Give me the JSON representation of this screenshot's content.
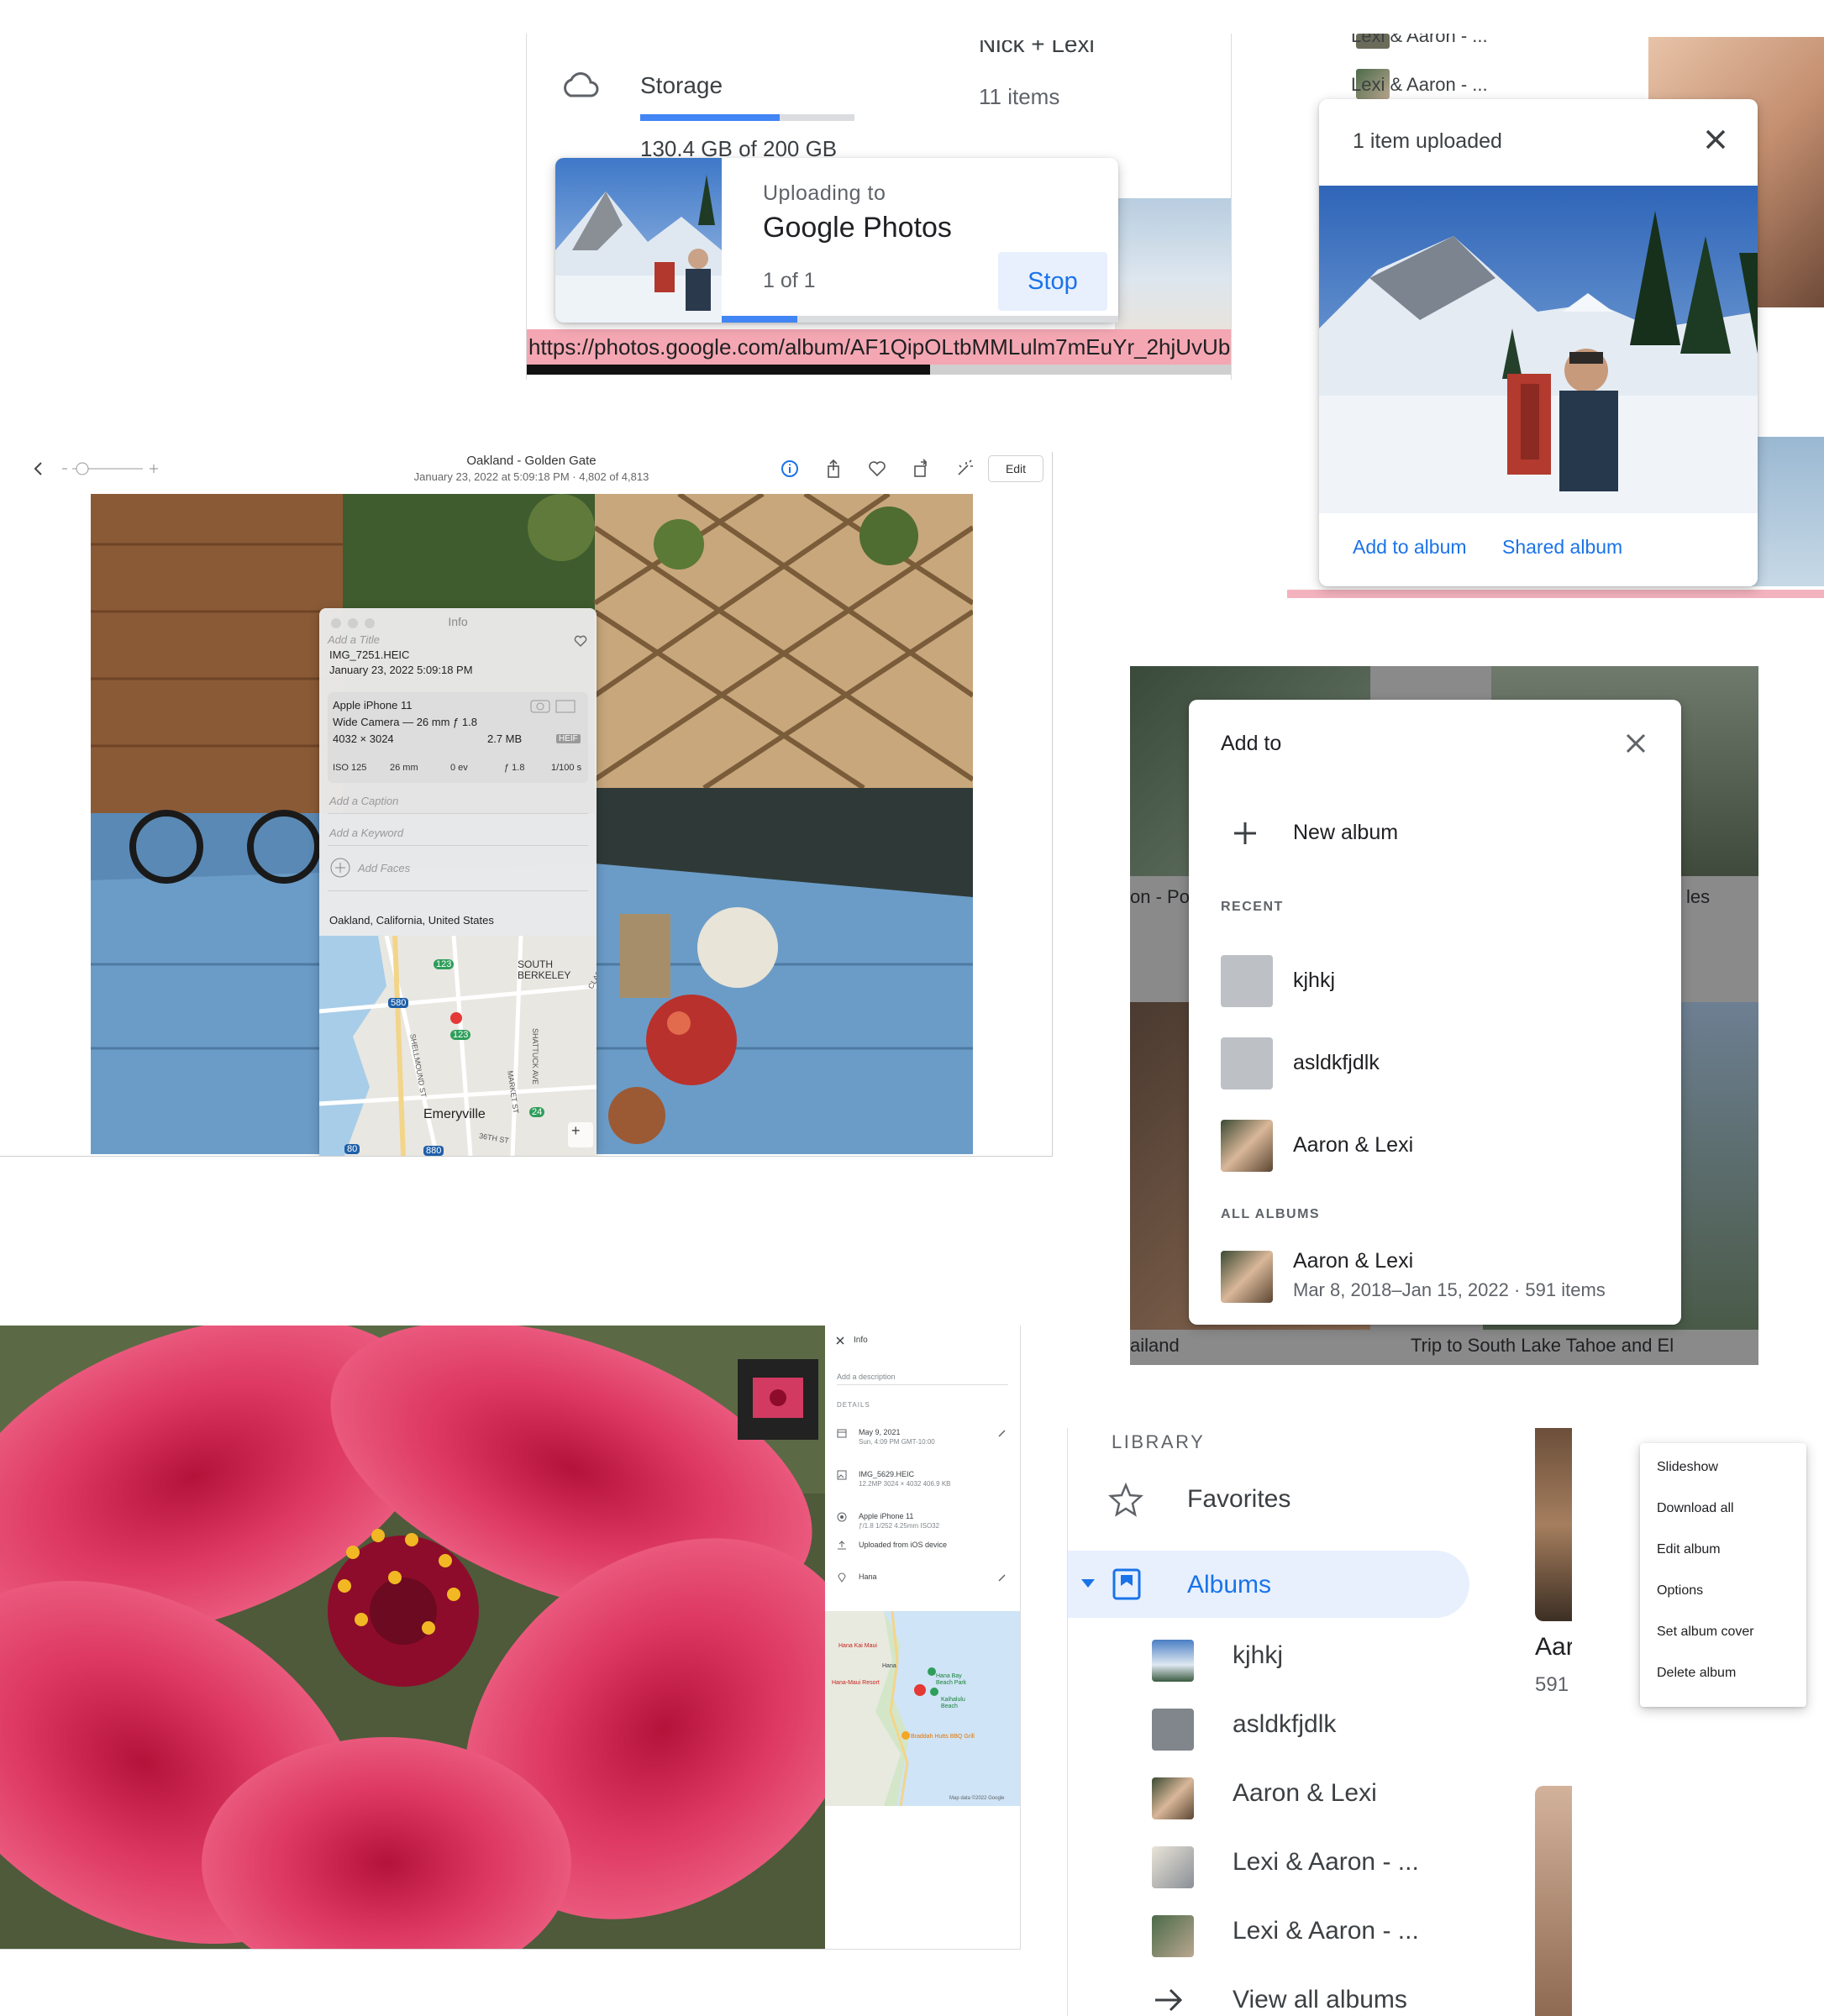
{
  "storage_panel": {
    "title": "Storage",
    "usage_text": "130.4 GB of 200 GB",
    "usage_fraction": 0.652,
    "album_title": "Nick + Lexi",
    "album_count": "11 items",
    "url": "https://photos.google.com/album/AF1QipOLtbMMLulm7mEuYr_2hjUvUb6",
    "icon": "cloud-icon",
    "toast": {
      "label": "Uploading to",
      "destination": "Google Photos",
      "count": "1 of 1",
      "stop_label": "Stop",
      "progress_fraction": 0.19
    }
  },
  "uploaded_panel": {
    "top_items": [
      "Lexi & Aaron - ...",
      "Lexi & Aaron - ..."
    ],
    "title": "1 item uploaded",
    "add_to_album_label": "Add to album",
    "shared_album_label": "Shared album",
    "close_icon": "close-icon"
  },
  "macos_photos": {
    "title": "Oakland - Golden Gate",
    "subtitle": "January 23, 2022 at 5:09:18 PM  ·  4,802 of 4,813",
    "edit_label": "Edit",
    "info": {
      "header": "Info",
      "add_title": "Add a Title",
      "filename": "IMG_7251.HEIC",
      "datetime": "January 23, 2022   5:09:18 PM",
      "device": "Apple iPhone 11",
      "lens": "Wide Camera — 26 mm ƒ 1.8",
      "dimensions": "4032 × 3024",
      "filesize": "2.7 MB",
      "format": "HEIF",
      "exif": [
        "ISO 125",
        "26 mm",
        "0 ev",
        "ƒ 1.8",
        "1/100 s"
      ],
      "add_caption": "Add a Caption",
      "add_keyword": "Add a Keyword",
      "add_faces": "Add Faces",
      "location": "Oakland, California, United States",
      "map_labels": [
        "SOUTH BERKELEY",
        "Emeryville",
        "SHELLMOUND ST",
        "SHATTUCK AVE",
        "MARKET ST",
        "CLARE",
        "36TH ST"
      ],
      "route_badges": [
        "123",
        "580",
        "123",
        "24",
        "80",
        "880"
      ]
    }
  },
  "add_to_dialog": {
    "title": "Add to",
    "new_album_label": "New album",
    "recent_header": "RECENT",
    "recent": [
      "kjhkj",
      "asldkfjdlk",
      "Aaron & Lexi"
    ],
    "all_header": "ALL ALBUMS",
    "all": [
      {
        "name": "Aaron & Lexi",
        "meta": "Mar 8, 2018–Jan 15, 2022  ·  591 items"
      }
    ],
    "background_labels": [
      "on - Po",
      "les",
      "ailand",
      "Trip to South Lake Tahoe and El"
    ]
  },
  "google_info_panel": {
    "header": "Info",
    "description_placeholder": "Add a description",
    "details_header": "DETAILS",
    "date": "May 9, 2021",
    "date_sub": "Sun, 4:09 PM   GMT-10:00",
    "file": "IMG_5629.HEIC",
    "file_sub": "12.2MP   3024 × 4032   406.9 KB",
    "camera": "Apple iPhone 11",
    "camera_sub": "ƒ/1.8   1/252   4.25mm   ISO32",
    "upload_source": "Uploaded from iOS device",
    "location": "Hana",
    "map_labels": [
      "Hana Kai Maui",
      "Hana",
      "Hana-Maui Resort",
      "Hana Bay Beach Park",
      "Kaihalulu Beach",
      "Braddah Hutts BBQ Grill",
      "Map data ©2022 Google"
    ]
  },
  "library": {
    "header": "LIBRARY",
    "favorites_label": "Favorites",
    "albums_label": "Albums",
    "albums": [
      "kjhkj",
      "asldkfjdlk",
      "Aaron & Lexi",
      "Lexi & Aaron - ...",
      "Lexi & Aaron - ..."
    ],
    "view_all_label": "View all albums",
    "side_title": "Aar",
    "side_count": "591"
  },
  "context_menu": {
    "items": [
      "Slideshow",
      "Download all",
      "Edit album",
      "Options",
      "Set album cover",
      "Delete album"
    ]
  },
  "colors": {
    "accent": "#1a73e8",
    "progress": "#4285f4",
    "selected_bg": "#e8f0fe",
    "url_highlight": "#f4a7b2"
  }
}
